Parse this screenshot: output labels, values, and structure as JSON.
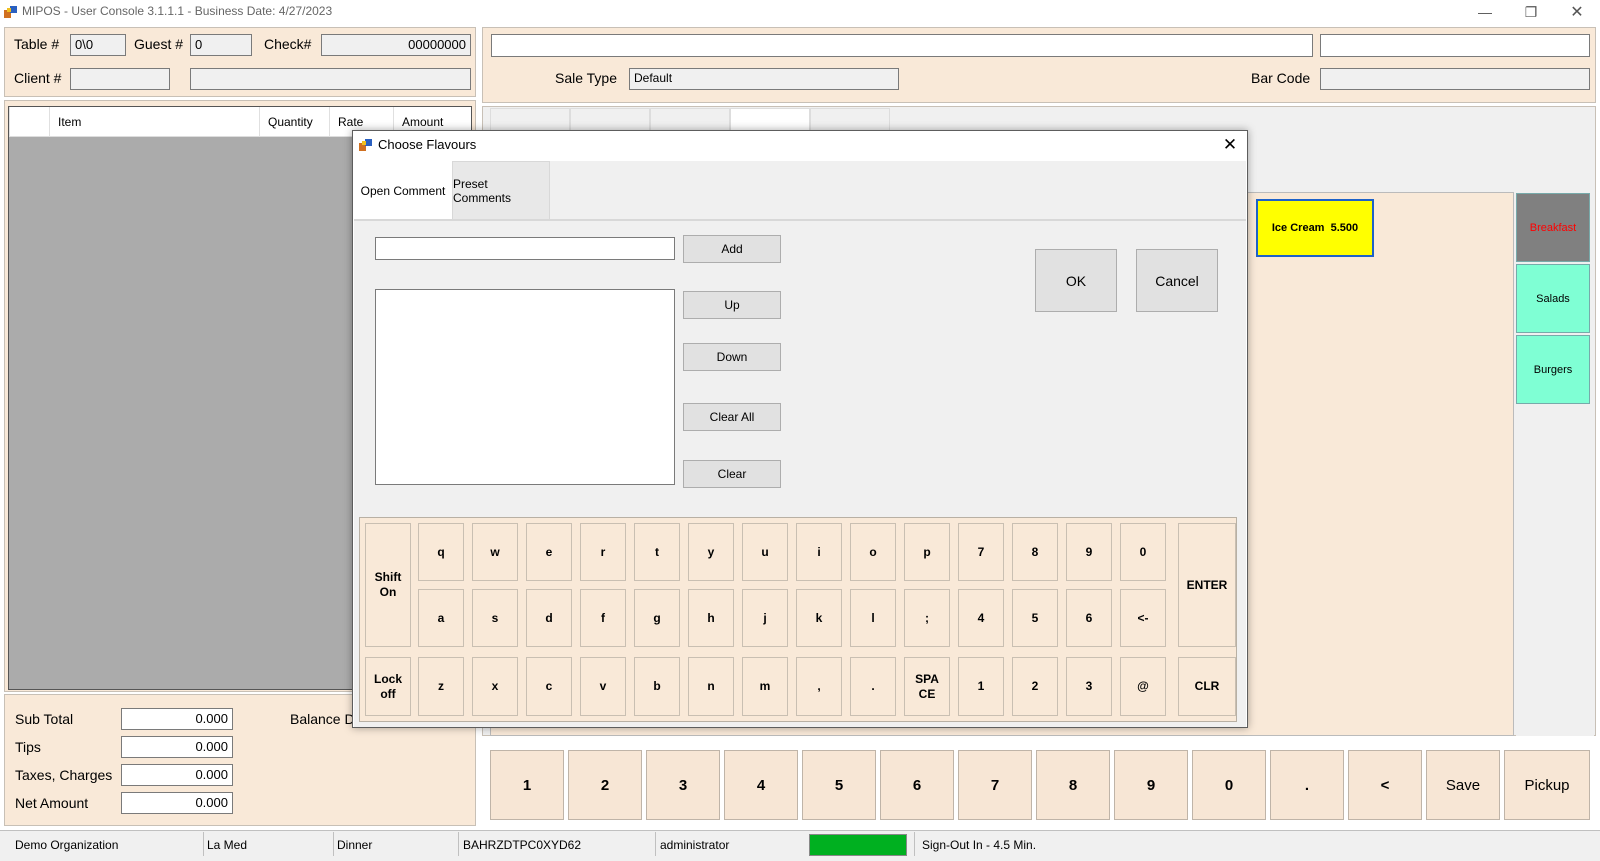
{
  "window": {
    "title": "MIPOS - User Console 3.1.1.1 - Business Date: 4/27/2023",
    "min_icon": "minimize-icon",
    "restore_icon": "restore-icon",
    "close_icon": "close-icon"
  },
  "header": {
    "table_label": "Table #",
    "table_value": "0\\0",
    "guest_label": "Guest #",
    "guest_value": "0",
    "check_label": "Check#",
    "check_value": "00000000",
    "client_label": "Client #",
    "client_value": "",
    "client_name": ""
  },
  "order_grid": {
    "columns": [
      "",
      "Item",
      "Quantity",
      "Rate",
      "Amount"
    ]
  },
  "totals": {
    "subtotal_label": "Sub Total",
    "subtotal_value": "0.000",
    "tips_label": "Tips",
    "tips_value": "0.000",
    "taxes_label": "Taxes, Charges",
    "taxes_value": "0.000",
    "net_label": "Net Amount",
    "net_value": "0.000",
    "balance_label": "Balance D"
  },
  "sale": {
    "sale_type_label": "Sale Type",
    "sale_type_value": "Default",
    "barcode_label": "Bar Code",
    "barcode_value": ""
  },
  "menu_item": {
    "label": "Ice Cream  5.500",
    "color": "#ffff00"
  },
  "categories": [
    {
      "label": "Breakfast",
      "color": "#808080",
      "text_color": "#ff0000"
    },
    {
      "label": "Salads",
      "color": "#7fffd4",
      "text_color": "#000000"
    },
    {
      "label": "Burgers",
      "color": "#7fffd4",
      "text_color": "#000000"
    }
  ],
  "numpad": [
    "1",
    "2",
    "3",
    "4",
    "5",
    "6",
    "7",
    "8",
    "9",
    "0",
    ".",
    "<",
    "Save",
    "Pickup"
  ],
  "statusbar": {
    "organization": "Demo Organization",
    "outlet": "La Med",
    "meal": "Dinner",
    "terminal": "BAHRZDTPC0XYD62",
    "user": "administrator",
    "indicator_color": "#00b020",
    "signout": "Sign-Out In - 4.5 Min."
  },
  "dialog": {
    "title": "Choose Flavours",
    "tabs": [
      "Open Comment",
      "Preset Comments"
    ],
    "comment_value": "",
    "buttons": {
      "add": "Add",
      "up": "Up",
      "down": "Down",
      "clear_all": "Clear All",
      "clear": "Clear",
      "ok": "OK",
      "cancel": "Cancel"
    },
    "keyboard": {
      "shift": "Shift On",
      "lock": "Lock off",
      "enter": "ENTER",
      "clr": "CLR",
      "row1": [
        "q",
        "w",
        "e",
        "r",
        "t",
        "y",
        "u",
        "i",
        "o",
        "p",
        "7",
        "8",
        "9",
        "0"
      ],
      "row2": [
        "a",
        "s",
        "d",
        "f",
        "g",
        "h",
        "j",
        "k",
        "l",
        ";",
        "4",
        "5",
        "6",
        "<-"
      ],
      "row3": [
        "z",
        "x",
        "c",
        "v",
        "b",
        "n",
        "m",
        ",",
        ".",
        "SPACE",
        "1",
        "2",
        "3",
        "@"
      ]
    }
  }
}
